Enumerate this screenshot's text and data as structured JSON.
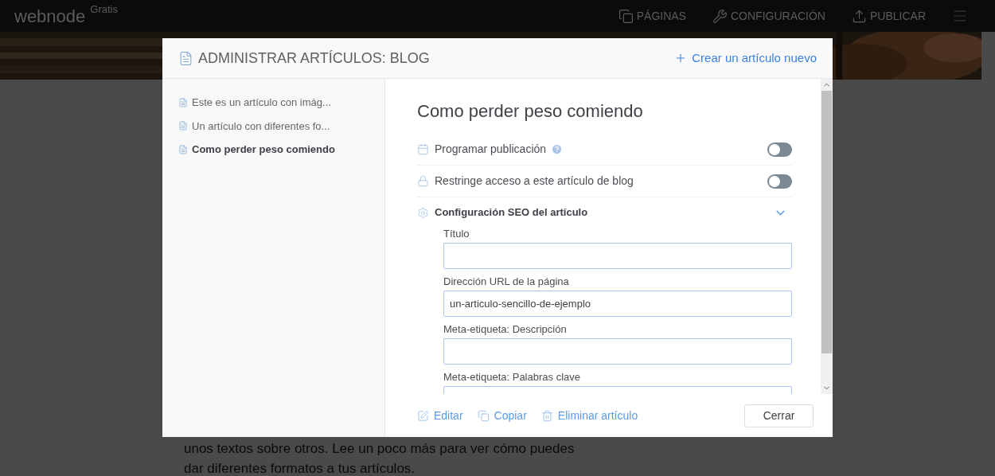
{
  "app_bar": {
    "logo": "webnode",
    "plan": "Gratis",
    "nav": [
      {
        "label": "PÁGINAS",
        "kind": "pages"
      },
      {
        "label": "CONFIGURACIÓN",
        "kind": "settings"
      },
      {
        "label": "PUBLICAR",
        "kind": "publish"
      }
    ]
  },
  "background_text": [
    "unos textos sobre otros. Lee un poco más para ver cómo puedes",
    "dar diferentes formatos a tus artículos."
  ],
  "modal": {
    "title": "ADMINISTRAR ARTÍCULOS: BLOG",
    "create_link": "Crear un artículo nuevo",
    "articles": [
      {
        "title": "Este es un artículo con imág...",
        "selected": false
      },
      {
        "title": "Un artículo con diferentes fo...",
        "selected": false
      },
      {
        "title": "Como perder peso comiendo",
        "selected": true
      }
    ],
    "heading": "Como perder peso comiendo",
    "options": [
      {
        "label": "Programar publicación",
        "kind": "schedule",
        "help": true,
        "on": false
      },
      {
        "label": "Restringe acceso a este artículo de blog",
        "kind": "lock",
        "help": false,
        "on": false
      }
    ],
    "seo": {
      "label": "Configuración SEO del artículo",
      "expanded": true,
      "fields": [
        {
          "label": "Título"
        },
        {
          "label": "Dirección URL de la página",
          "value": "un-articulo-sencillo-de-ejemplo"
        },
        {
          "label": "Meta-etiqueta: Descripción"
        },
        {
          "label": "Meta-etiqueta: Palabras clave"
        }
      ]
    },
    "actions": [
      {
        "label": "Editar",
        "kind": "edit"
      },
      {
        "label": "Copiar",
        "kind": "copy"
      },
      {
        "label": "Eliminar artículo",
        "kind": "delete"
      }
    ],
    "close": "Cerrar"
  }
}
